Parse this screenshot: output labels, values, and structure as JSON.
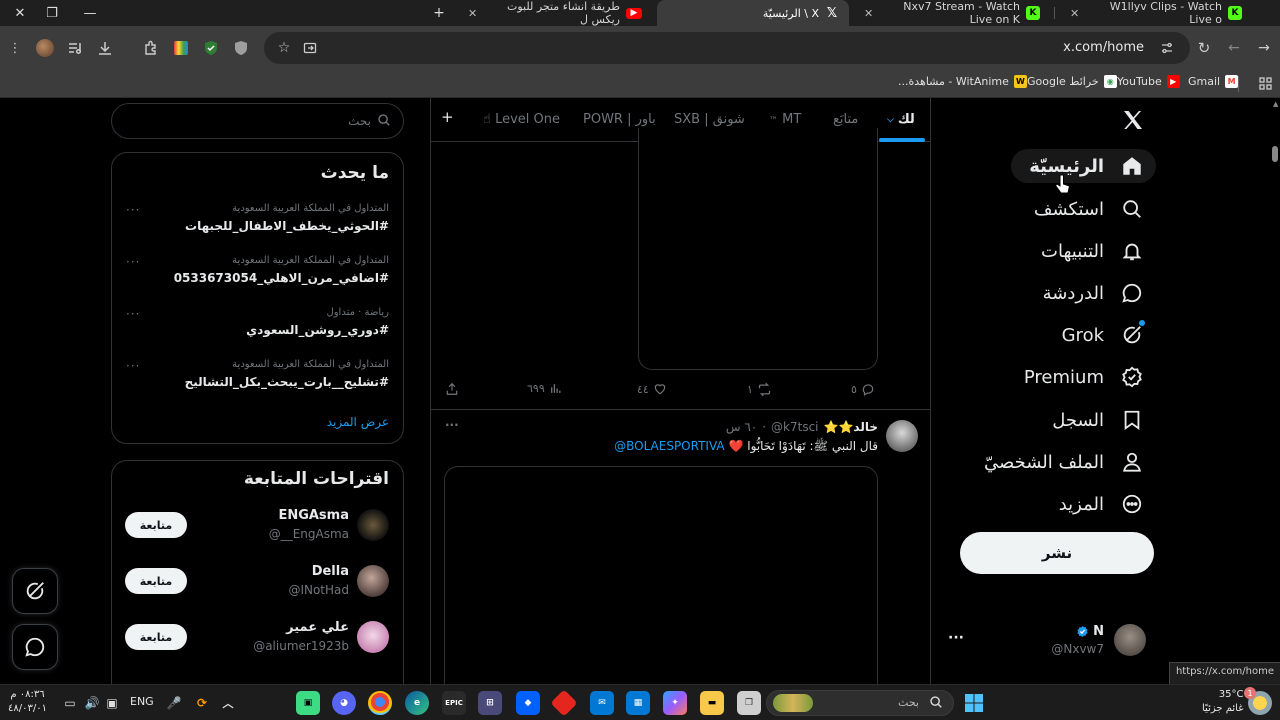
{
  "browser": {
    "tabs": [
      {
        "title": "W1llyv Clips - Watch Live o",
        "favicon": "kick",
        "active": false
      },
      {
        "title": "Nxv7 Stream - Watch Live on K",
        "favicon": "kick",
        "active": false
      },
      {
        "title": "X \\ الرئيسيّة",
        "favicon": "x",
        "active": true
      },
      {
        "title": "طريقة انشاء متجر للبوت ريكس ل",
        "favicon": "youtube",
        "active": false
      }
    ],
    "new_tab_label": "+",
    "url": "x.com/home",
    "bookmarks": [
      {
        "label": "Gmail",
        "color": "#ea4335",
        "glyph": "M"
      },
      {
        "label": "YouTube",
        "color": "#ff0000",
        "glyph": "▶"
      },
      {
        "label": "خرائط Google",
        "color": "#34a853",
        "glyph": "◉"
      },
      {
        "label": "WitAnime - مشاهدة...",
        "color": "#f5c518",
        "glyph": "W"
      }
    ],
    "status_url": "https://x.com/home"
  },
  "x": {
    "nav": [
      {
        "label": "الرئيسيّة",
        "icon": "home-icon",
        "active": true
      },
      {
        "label": "استكشف",
        "icon": "search-icon"
      },
      {
        "label": "التنبيهات",
        "icon": "bell-icon"
      },
      {
        "label": "الدردشة",
        "icon": "chat-icon"
      },
      {
        "label": "Grok",
        "icon": "grok-icon"
      },
      {
        "label": "Premium",
        "icon": "verified-icon"
      },
      {
        "label": "السجل",
        "icon": "bookmark-icon"
      },
      {
        "label": "الملف الشخصيّ",
        "icon": "profile-icon"
      },
      {
        "label": "المزيد",
        "icon": "more-icon"
      }
    ],
    "post_button": "نشر",
    "account": {
      "name": "N",
      "handle": "@Nxvw7",
      "more": "···"
    },
    "feed_tabs": [
      "لك",
      "متابَع",
      "MT",
      "SXB | شونق",
      "POWR | باور",
      "Level One"
    ],
    "feed_tab_prefix": {
      "MT": "™",
      "Level One": "☝"
    },
    "add_tab": "+",
    "post1": {
      "replies": "٥",
      "reposts": "١",
      "likes": "٤٤",
      "views": "٦٩٩"
    },
    "post2": {
      "author": "خالد⭐⭐",
      "handle": "@k7tsci",
      "time": "٦٠ س",
      "separator": "·",
      "text_before": "قال النبي ﷺ: تَهَادَوْا تَحَابُّوا",
      "heart": "❤️",
      "mention": "@BOLAESPORTIVA"
    }
  },
  "sidebar": {
    "search_placeholder": "بحث",
    "trends_title": "ما يحدث",
    "trends": [
      {
        "meta": "المتداول في المملكة العربية السعودية",
        "name": "#الحوثي_يخطف_الاطفال_للجبهات"
      },
      {
        "meta": "المتداول في المملكة العربية السعودية",
        "name": "#اضافي_مرن_الاهلي_0533673054"
      },
      {
        "meta": "رياضة · متداول",
        "name": "#دوري_روشن_السعودي"
      },
      {
        "meta": "المتداول في المملكة العربية السعودية",
        "name": "#تشليح__بارت_يبحث_بكل_التشاليح"
      }
    ],
    "show_more": "عرض المزيد",
    "follow_title": "اقتراحات المتابعة",
    "follow": [
      {
        "name": "ENGAsma",
        "handle": "@__EngAsma",
        "button": "متابعة"
      },
      {
        "name": "Della",
        "handle": "@INotHad",
        "button": "متابعة"
      },
      {
        "name": "علي عمير",
        "handle": "@aliumer1923b",
        "button": "متابعة"
      }
    ]
  },
  "taskbar": {
    "time": "٠٨:٣٦ م",
    "date": "٤٨/٠٣/٠١",
    "language": "ENG",
    "search_placeholder": "بحث",
    "weather_temp": "35°C",
    "weather_desc": "غائم جزئيًا",
    "notification_count": "1"
  }
}
